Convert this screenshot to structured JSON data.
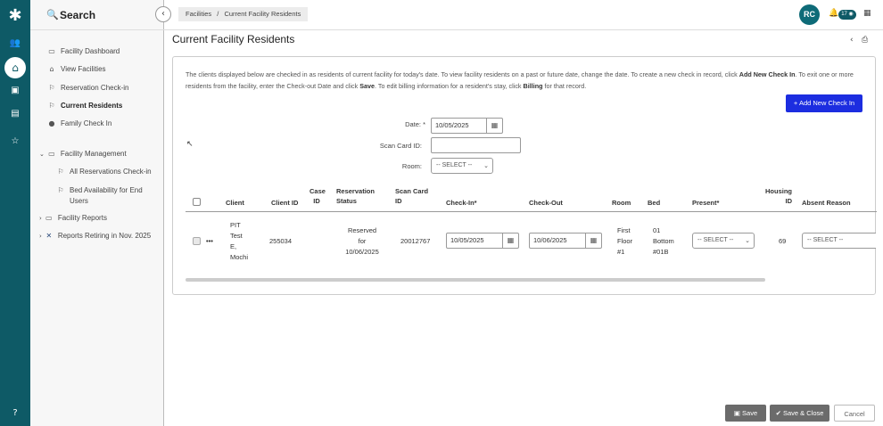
{
  "rail": {
    "logo": "✱",
    "icons": [
      "people-icon",
      "home-icon",
      "id-card-icon",
      "document-icon",
      "star-icon",
      "help-icon"
    ]
  },
  "sidebar": {
    "search_label": "Search",
    "items": [
      {
        "label": "Facility Dashboard",
        "icon": "map-icon"
      },
      {
        "label": "View Facilities",
        "icon": "building-icon"
      },
      {
        "label": "Reservation Check-in",
        "icon": "flag-icon"
      },
      {
        "label": "Current Residents",
        "icon": "flag-icon"
      },
      {
        "label": "Family Check In",
        "icon": "person-icon"
      },
      {
        "label": "Facility Management",
        "icon": "folder-icon"
      },
      {
        "label": "All Reservations Check-in",
        "icon": "flag-icon"
      },
      {
        "label": "Bed Availability for End",
        "label2": "Users",
        "icon": "flag-icon"
      },
      {
        "label": "Facility Reports",
        "icon": "folder-icon"
      },
      {
        "label": "Reports Retiring in Nov. 2025",
        "icon": "x-icon"
      }
    ]
  },
  "breadcrumb": {
    "root": "Facilities",
    "sep": "/",
    "current": "Current Facility Residents"
  },
  "header": {
    "avatar": "RC",
    "notif_count": "17"
  },
  "page": {
    "title": "Current Facility Residents"
  },
  "info": {
    "t1": "The clients displayed below are checked in as residents of current facility for today's date.  To view facility residents on a past or future date, change the date.  To create a new check in record, click ",
    "b1": "Add New Check In",
    "t2": ".  To exit one or more residents from the facility, enter the Check-out Date and click ",
    "b2": "Save",
    "t3": ".  To edit billing information for a resident's stay, click ",
    "b3": "Billing",
    "t4": " for that record."
  },
  "add_button": "+ Add New Check In",
  "form": {
    "date_label": "Date: *",
    "date_value": "10/05/2025",
    "scan_label": "Scan Card ID:",
    "room_label": "Room:",
    "room_value": "-- SELECT --"
  },
  "table": {
    "headers": {
      "client": "Client",
      "client_id": "Client ID",
      "case_id_1": "Case",
      "case_id_2": "ID",
      "res_1": "Reservation",
      "res_2": "Status",
      "scan_1": "Scan Card",
      "scan_2": "ID",
      "checkin": "Check-In*",
      "checkout": "Check-Out",
      "room": "Room",
      "bed": "Bed",
      "present": "Present*",
      "housing_1": "Housing",
      "housing_2": "ID",
      "absent": "Absent Reason"
    },
    "row": {
      "client_1": "PIT",
      "client_2": "Test",
      "client_3": "E,",
      "client_4": "Mochi",
      "client_id": "255034",
      "status_1": "Reserved",
      "status_2": "for",
      "status_3": "10/06/2025",
      "scan_id": "20012767",
      "checkin": "10/05/2025",
      "checkout": "10/06/2025",
      "room_1": "First",
      "room_2": "Floor",
      "room_3": "#1",
      "bed_1": "01",
      "bed_2": "Bottom",
      "bed_3": "#01B",
      "present": "-- SELECT --",
      "housing_id": "69",
      "absent": "-- SELECT --",
      "more": "•••"
    }
  },
  "footer": {
    "save": "Save",
    "save_close": "Save & Close",
    "cancel": "Cancel"
  }
}
